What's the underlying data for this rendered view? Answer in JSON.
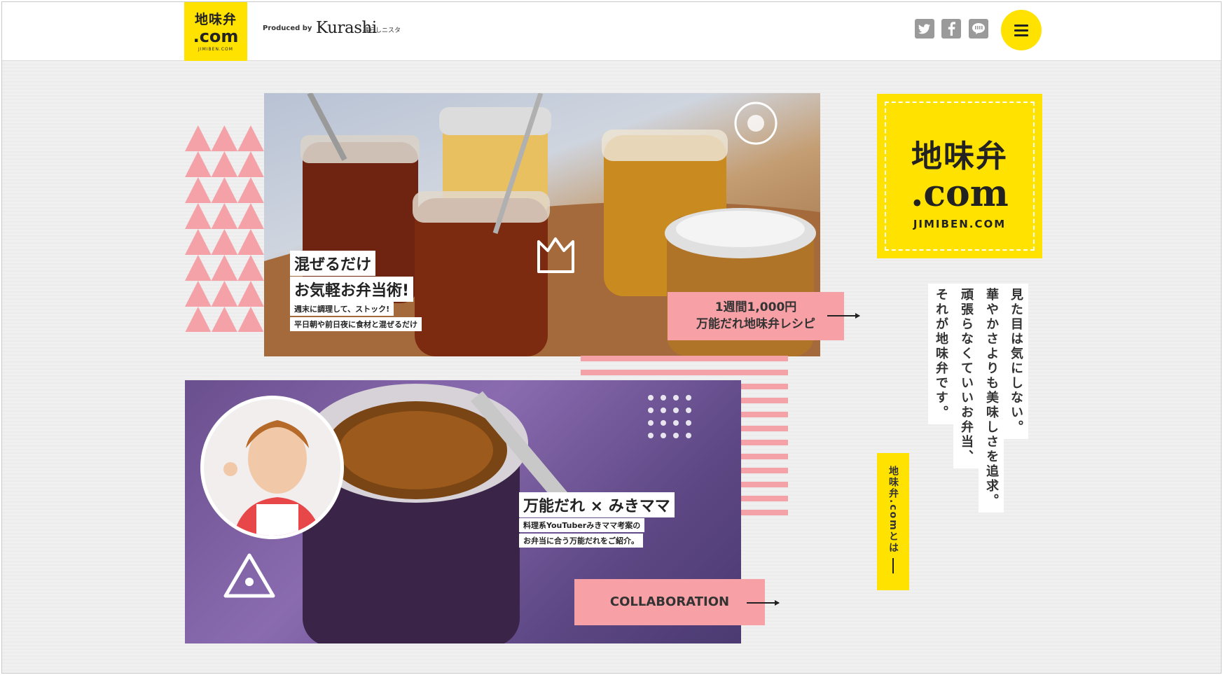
{
  "header": {
    "logo_line1": "地味弁",
    "logo_line2": ".com",
    "logo_line3": "JIMIBEN.COM",
    "produced_by": "Produced by",
    "brand": "Kurashi",
    "brand_sub": "暮らしニスタ",
    "sns": [
      "twitter-icon",
      "facebook-icon",
      "line-icon"
    ],
    "menu": "menu-icon"
  },
  "hero1": {
    "title_line1": "混ぜるだけ",
    "title_line2": "お気軽お弁当術!",
    "sub_line1": "週末に調理して、ストック!",
    "sub_line2": "平日朝や前日夜に食材と混ぜるだけ",
    "cta_line1": "1週間1,000円",
    "cta_line2": "万能だれ地味弁レシピ"
  },
  "hero2": {
    "title": "万能だれ × みきママ",
    "sub_line1": "料理系YouTuberみきママ考案の",
    "sub_line2": "お弁当に合う万能だれをご紹介。",
    "cta": "COLLABORATION"
  },
  "brand_box": {
    "line1": "地味弁",
    "line2": ".com",
    "line3": "JIMIBEN.COM"
  },
  "tagline": {
    "col1": "見た目は気にしない。",
    "col2": "華やかさよりも美味しさを追求。",
    "col3": "頑張らなくていいお弁当、",
    "col4": "それが地味弁です。"
  },
  "about_label": "地味弁.comとは"
}
